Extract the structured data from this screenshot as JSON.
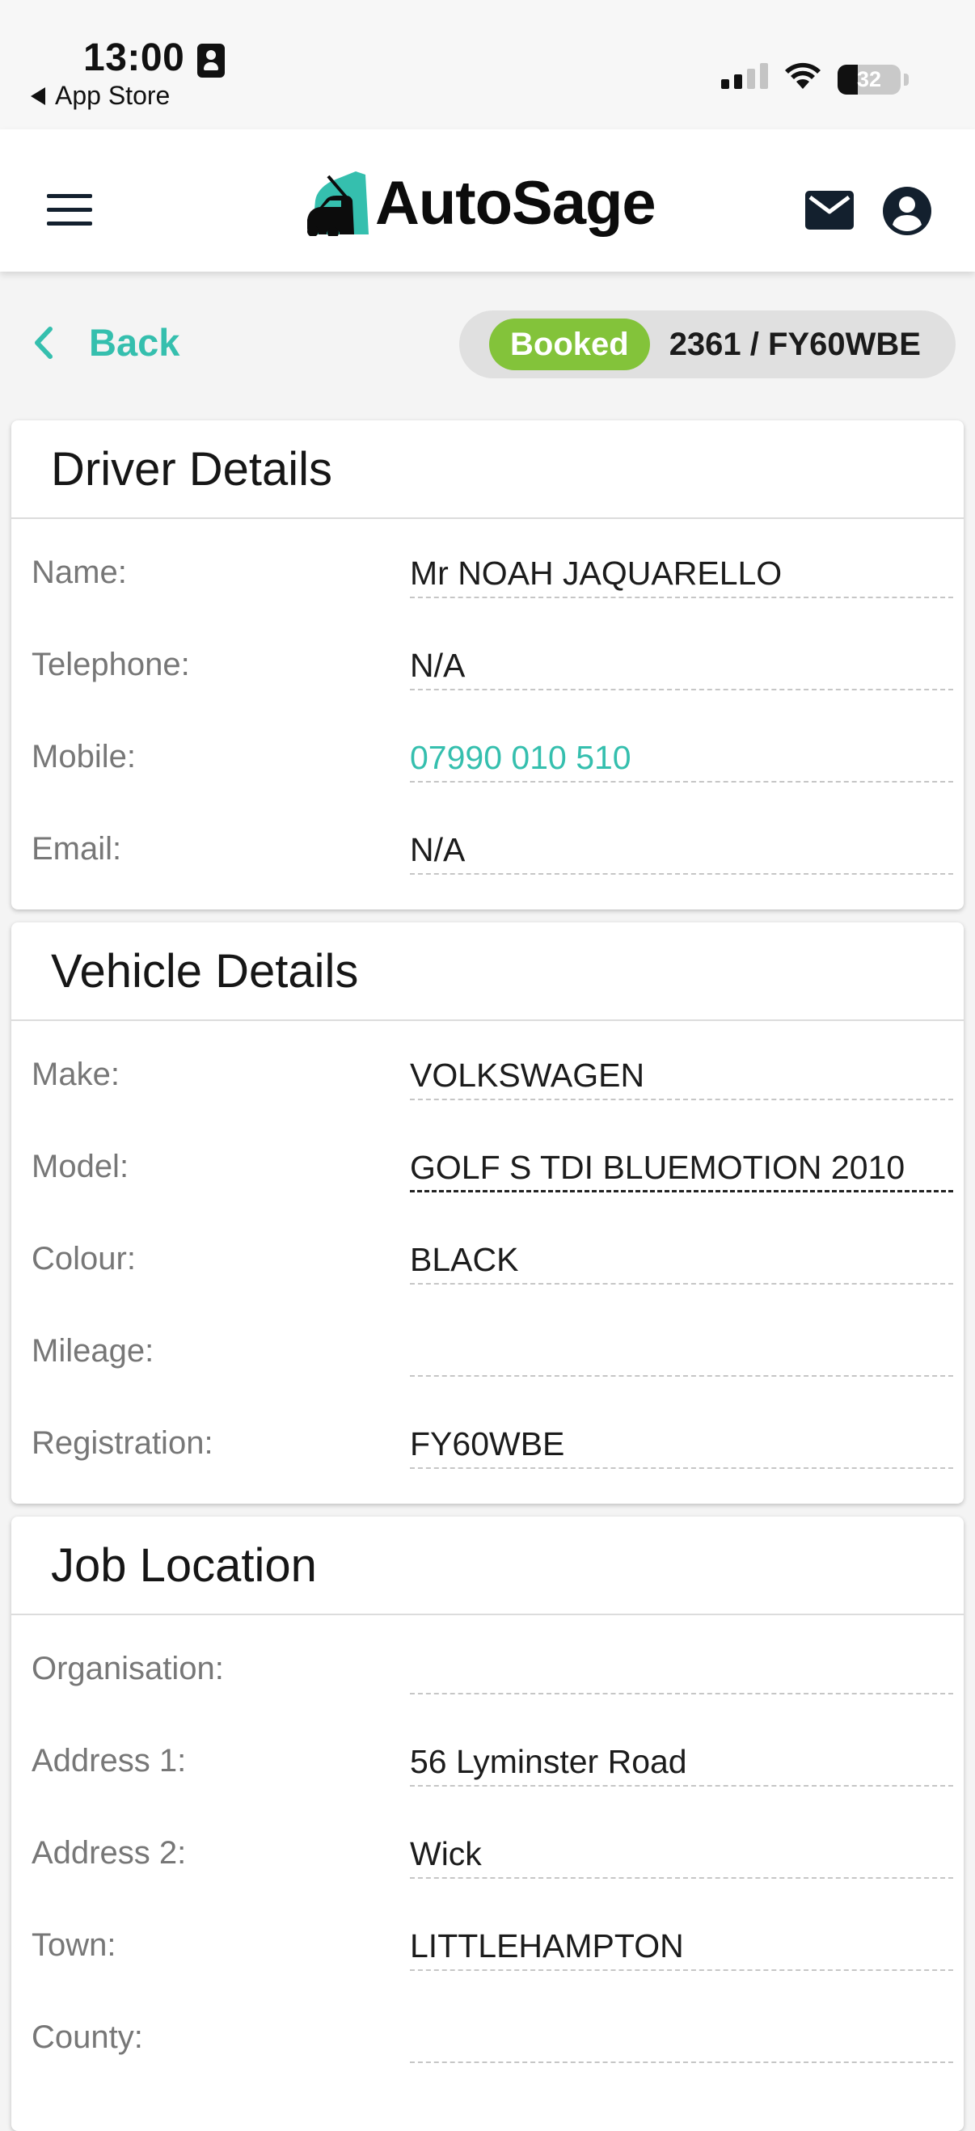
{
  "status_bar": {
    "time": "13:00",
    "back_app": "App Store",
    "battery_percent": "32",
    "battery_level": 0.32
  },
  "header": {
    "logo_text": "AutoSage",
    "menu_icon": "hamburger-menu-icon",
    "mail_icon": "mail-icon",
    "account_icon": "user-account-icon"
  },
  "nav": {
    "back_label": "Back",
    "status": "Booked",
    "job_ref": "2361 / FY60WBE"
  },
  "colors": {
    "accent": "#35bfae",
    "status_booked": "#83c33a",
    "header_icons": "#13202e"
  },
  "driver_details": {
    "title": "Driver Details",
    "rows": [
      {
        "label": "Name:",
        "value": "Mr NOAH JAQUARELLO"
      },
      {
        "label": "Telephone:",
        "value": "N/A"
      },
      {
        "label": "Mobile:",
        "value": "07990 010 510"
      },
      {
        "label": "Email:",
        "value": "N/A"
      }
    ]
  },
  "vehicle_details": {
    "title": "Vehicle Details",
    "rows": [
      {
        "label": "Make:",
        "value": "VOLKSWAGEN"
      },
      {
        "label": "Model:",
        "value": "GOLF S TDI BLUEMOTION 2010"
      },
      {
        "label": "Colour:",
        "value": "BLACK"
      },
      {
        "label": "Mileage:",
        "value": ""
      },
      {
        "label": "Registration:",
        "value": "FY60WBE"
      }
    ]
  },
  "job_location": {
    "title": "Job Location",
    "rows": [
      {
        "label": "Organisation:",
        "value": ""
      },
      {
        "label": "Address 1:",
        "value": "56 Lyminster Road"
      },
      {
        "label": "Address 2:",
        "value": "Wick"
      },
      {
        "label": "Town:",
        "value": "LITTLEHAMPTON"
      },
      {
        "label": "County:",
        "value": ""
      }
    ]
  }
}
